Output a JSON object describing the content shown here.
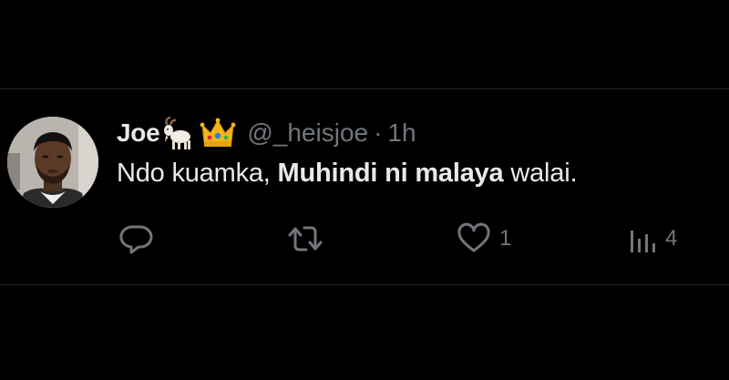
{
  "tweet": {
    "display_name": "Joe",
    "emoji_1": "goat-emoji",
    "emoji_2": "crown-emoji",
    "handle": "@_heisjoe",
    "separator": "·",
    "time": "1h",
    "text_part_1": "Ndo kuamka, ",
    "text_bold": "Muhindi ni malaya",
    "text_part_2": " walai."
  },
  "actions": {
    "reply_icon": "reply-icon",
    "retweet_icon": "retweet-icon",
    "like_icon": "heart-icon",
    "like_count": "1",
    "views_icon": "views-icon",
    "views_count": "4"
  },
  "colors": {
    "background": "#000000",
    "primary_text": "#e7e9ea",
    "secondary_text": "#71767b",
    "divider": "#202327"
  }
}
